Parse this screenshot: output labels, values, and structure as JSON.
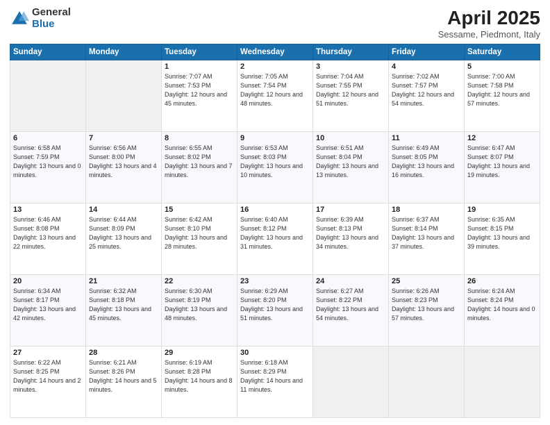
{
  "logo": {
    "general": "General",
    "blue": "Blue"
  },
  "header": {
    "title": "April 2025",
    "subtitle": "Sessame, Piedmont, Italy"
  },
  "weekdays": [
    "Sunday",
    "Monday",
    "Tuesday",
    "Wednesday",
    "Thursday",
    "Friday",
    "Saturday"
  ],
  "weeks": [
    [
      {
        "day": "",
        "text": ""
      },
      {
        "day": "",
        "text": ""
      },
      {
        "day": "1",
        "text": "Sunrise: 7:07 AM\nSunset: 7:53 PM\nDaylight: 12 hours and 45 minutes."
      },
      {
        "day": "2",
        "text": "Sunrise: 7:05 AM\nSunset: 7:54 PM\nDaylight: 12 hours and 48 minutes."
      },
      {
        "day": "3",
        "text": "Sunrise: 7:04 AM\nSunset: 7:55 PM\nDaylight: 12 hours and 51 minutes."
      },
      {
        "day": "4",
        "text": "Sunrise: 7:02 AM\nSunset: 7:57 PM\nDaylight: 12 hours and 54 minutes."
      },
      {
        "day": "5",
        "text": "Sunrise: 7:00 AM\nSunset: 7:58 PM\nDaylight: 12 hours and 57 minutes."
      }
    ],
    [
      {
        "day": "6",
        "text": "Sunrise: 6:58 AM\nSunset: 7:59 PM\nDaylight: 13 hours and 0 minutes."
      },
      {
        "day": "7",
        "text": "Sunrise: 6:56 AM\nSunset: 8:00 PM\nDaylight: 13 hours and 4 minutes."
      },
      {
        "day": "8",
        "text": "Sunrise: 6:55 AM\nSunset: 8:02 PM\nDaylight: 13 hours and 7 minutes."
      },
      {
        "day": "9",
        "text": "Sunrise: 6:53 AM\nSunset: 8:03 PM\nDaylight: 13 hours and 10 minutes."
      },
      {
        "day": "10",
        "text": "Sunrise: 6:51 AM\nSunset: 8:04 PM\nDaylight: 13 hours and 13 minutes."
      },
      {
        "day": "11",
        "text": "Sunrise: 6:49 AM\nSunset: 8:05 PM\nDaylight: 13 hours and 16 minutes."
      },
      {
        "day": "12",
        "text": "Sunrise: 6:47 AM\nSunset: 8:07 PM\nDaylight: 13 hours and 19 minutes."
      }
    ],
    [
      {
        "day": "13",
        "text": "Sunrise: 6:46 AM\nSunset: 8:08 PM\nDaylight: 13 hours and 22 minutes."
      },
      {
        "day": "14",
        "text": "Sunrise: 6:44 AM\nSunset: 8:09 PM\nDaylight: 13 hours and 25 minutes."
      },
      {
        "day": "15",
        "text": "Sunrise: 6:42 AM\nSunset: 8:10 PM\nDaylight: 13 hours and 28 minutes."
      },
      {
        "day": "16",
        "text": "Sunrise: 6:40 AM\nSunset: 8:12 PM\nDaylight: 13 hours and 31 minutes."
      },
      {
        "day": "17",
        "text": "Sunrise: 6:39 AM\nSunset: 8:13 PM\nDaylight: 13 hours and 34 minutes."
      },
      {
        "day": "18",
        "text": "Sunrise: 6:37 AM\nSunset: 8:14 PM\nDaylight: 13 hours and 37 minutes."
      },
      {
        "day": "19",
        "text": "Sunrise: 6:35 AM\nSunset: 8:15 PM\nDaylight: 13 hours and 39 minutes."
      }
    ],
    [
      {
        "day": "20",
        "text": "Sunrise: 6:34 AM\nSunset: 8:17 PM\nDaylight: 13 hours and 42 minutes."
      },
      {
        "day": "21",
        "text": "Sunrise: 6:32 AM\nSunset: 8:18 PM\nDaylight: 13 hours and 45 minutes."
      },
      {
        "day": "22",
        "text": "Sunrise: 6:30 AM\nSunset: 8:19 PM\nDaylight: 13 hours and 48 minutes."
      },
      {
        "day": "23",
        "text": "Sunrise: 6:29 AM\nSunset: 8:20 PM\nDaylight: 13 hours and 51 minutes."
      },
      {
        "day": "24",
        "text": "Sunrise: 6:27 AM\nSunset: 8:22 PM\nDaylight: 13 hours and 54 minutes."
      },
      {
        "day": "25",
        "text": "Sunrise: 6:26 AM\nSunset: 8:23 PM\nDaylight: 13 hours and 57 minutes."
      },
      {
        "day": "26",
        "text": "Sunrise: 6:24 AM\nSunset: 8:24 PM\nDaylight: 14 hours and 0 minutes."
      }
    ],
    [
      {
        "day": "27",
        "text": "Sunrise: 6:22 AM\nSunset: 8:25 PM\nDaylight: 14 hours and 2 minutes."
      },
      {
        "day": "28",
        "text": "Sunrise: 6:21 AM\nSunset: 8:26 PM\nDaylight: 14 hours and 5 minutes."
      },
      {
        "day": "29",
        "text": "Sunrise: 6:19 AM\nSunset: 8:28 PM\nDaylight: 14 hours and 8 minutes."
      },
      {
        "day": "30",
        "text": "Sunrise: 6:18 AM\nSunset: 8:29 PM\nDaylight: 14 hours and 11 minutes."
      },
      {
        "day": "",
        "text": ""
      },
      {
        "day": "",
        "text": ""
      },
      {
        "day": "",
        "text": ""
      }
    ]
  ]
}
